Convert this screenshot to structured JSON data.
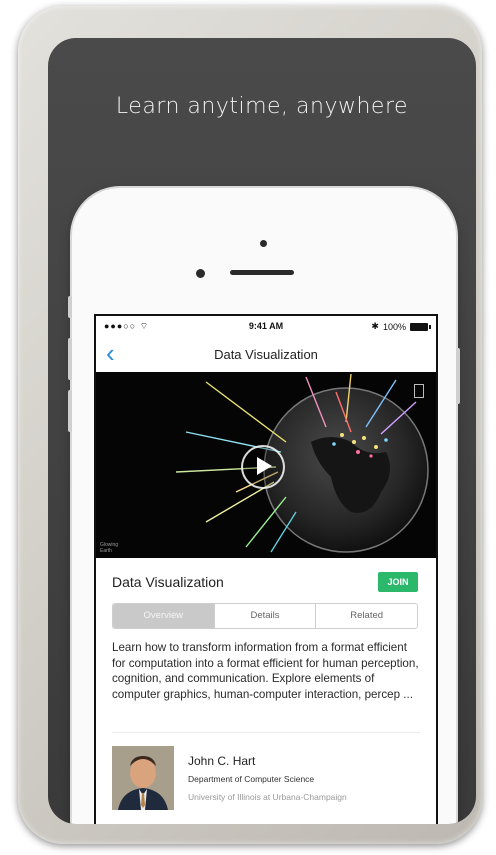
{
  "banner": {
    "headline": "Learn anytime, anywhere"
  },
  "status_bar": {
    "signal": "●●●○○",
    "time": "9:41 AM",
    "battery_text": "100%"
  },
  "nav": {
    "back_glyph": "‹",
    "title": "Data Visualization"
  },
  "video": {
    "watermark": "Glowing Earth"
  },
  "course": {
    "title": "Data Visualization",
    "join_label": "JOIN",
    "tabs": [
      {
        "label": "Overview",
        "active": true
      },
      {
        "label": "Details",
        "active": false
      },
      {
        "label": "Related",
        "active": false
      }
    ],
    "description": "Learn how to transform information from a format efficient for computation into a format efficient for human perception, cognition, and communication. Explore elements of computer graphics, human-computer interaction, percep ..."
  },
  "instructor": {
    "name": "John C. Hart",
    "department": "Department of Computer Science",
    "university": "University of Illinois at Urbana-Champaign"
  },
  "colors": {
    "accent_blue": "#2a8ddc",
    "join_green": "#2cb86a",
    "panel_dark": "#3f3f3f"
  }
}
